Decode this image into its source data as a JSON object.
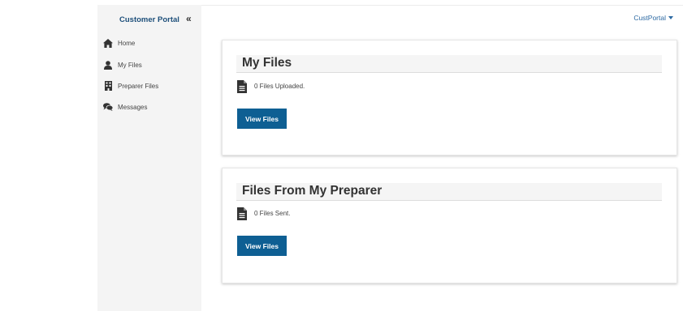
{
  "sidebar": {
    "brand": "Customer Portal",
    "collapse_glyph": "«",
    "items": [
      {
        "label": "Home",
        "icon": "home-icon"
      },
      {
        "label": "My Files",
        "icon": "user-icon"
      },
      {
        "label": "Preparer Files",
        "icon": "building-icon"
      },
      {
        "label": "Messages",
        "icon": "comments-icon"
      }
    ]
  },
  "header": {
    "user_menu_label": "CustPortal"
  },
  "cards": [
    {
      "title": "My Files",
      "count_text": "0 Files Uploaded.",
      "button_label": "View Files"
    },
    {
      "title": "Files From My Preparer",
      "count_text": "0 Files Sent.",
      "button_label": "View Files"
    }
  ],
  "colors": {
    "brand": "#1d4f7a",
    "button": "#0e5f93",
    "link": "#2d6aa3",
    "sidebar_bg": "#f4f4f4"
  }
}
